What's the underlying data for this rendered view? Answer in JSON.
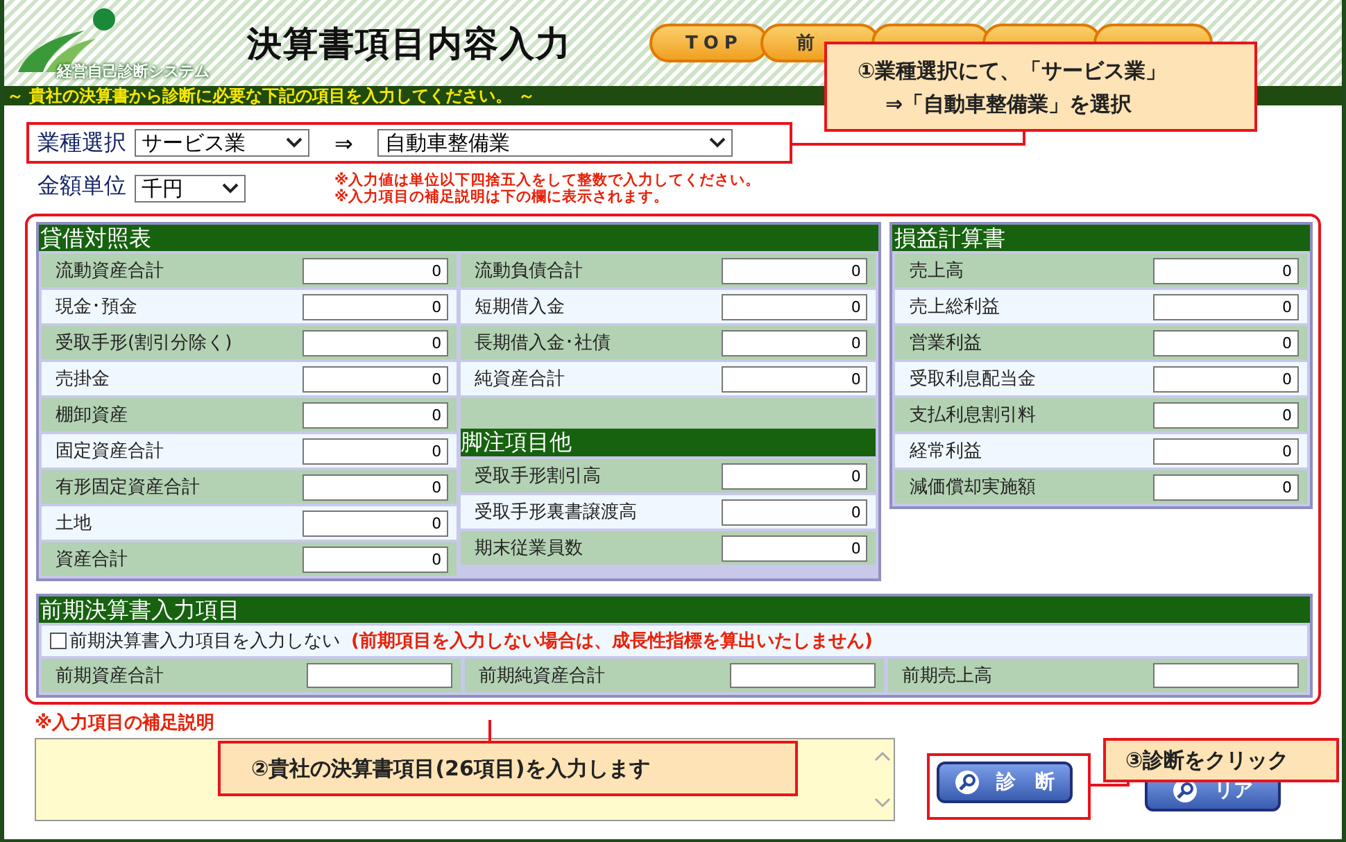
{
  "header": {
    "logo_text": "経営自己診断システム",
    "title": "決算書項目内容入力",
    "nav": [
      "TOP",
      "前"
    ],
    "notice": "～ 貴社の決算書から診断に必要な下記の項目を入力してください。 ～"
  },
  "selection": {
    "industry_label": "業種選択",
    "major": "サービス業",
    "arrow": "⇒",
    "minor": "自動車整備業",
    "unit_label": "金額単位",
    "unit": "千円",
    "notes": [
      "※入力値は単位以下四捨五入をして整数で入力してください。",
      "※入力項目の補足説明は下の欄に表示されます。"
    ]
  },
  "balance_sheet": {
    "title": "貸借対照表",
    "left_items": [
      {
        "label": "流動資産合計",
        "value": "0"
      },
      {
        "label": "現金･預金",
        "value": "0"
      },
      {
        "label": "受取手形(割引分除く)",
        "value": "0"
      },
      {
        "label": "売掛金",
        "value": "0"
      },
      {
        "label": "棚卸資産",
        "value": "0"
      },
      {
        "label": "固定資産合計",
        "value": "0"
      },
      {
        "label": "有形固定資産合計",
        "value": "0"
      },
      {
        "label": "土地",
        "value": "0"
      },
      {
        "label": "資産合計",
        "value": "0"
      }
    ],
    "right_items": [
      {
        "label": "流動負債合計",
        "value": "0"
      },
      {
        "label": "短期借入金",
        "value": "0"
      },
      {
        "label": "長期借入金･社債",
        "value": "0"
      },
      {
        "label": "純資産合計",
        "value": "0"
      }
    ],
    "footnote": {
      "title": "脚注項目他",
      "items": [
        {
          "label": "受取手形割引高",
          "value": "0"
        },
        {
          "label": "受取手形裏書譲渡高",
          "value": "0"
        },
        {
          "label": "期末従業員数",
          "value": "0"
        }
      ]
    }
  },
  "income_statement": {
    "title": "損益計算書",
    "items": [
      {
        "label": "売上高",
        "value": "0"
      },
      {
        "label": "売上総利益",
        "value": "0"
      },
      {
        "label": "営業利益",
        "value": "0"
      },
      {
        "label": "受取利息配当金",
        "value": "0"
      },
      {
        "label": "支払利息割引料",
        "value": "0"
      },
      {
        "label": "経常利益",
        "value": "0"
      },
      {
        "label": "減価償却実施額",
        "value": "0"
      }
    ]
  },
  "previous": {
    "title": "前期決算書入力項目",
    "checkbox": {
      "label": "前期決算書入力項目を入力しない",
      "checked": false
    },
    "warning": "(前期項目を入力しない場合は、成長性指標を算出いたしません)",
    "fields": [
      {
        "label": "前期資産合計"
      },
      {
        "label": "前期純資産合計"
      },
      {
        "label": "前期売上高"
      }
    ]
  },
  "supplement": {
    "label": "※入力項目の補足説明"
  },
  "buttons": [
    {
      "kind": "diagnose",
      "label": "診　断"
    },
    {
      "kind": "clear",
      "label": "リア"
    }
  ],
  "callouts": [
    {
      "lines": [
        "①業種選択にて、「サービス業」",
        "⇒「自動車整備業」を選択"
      ]
    },
    {
      "lines": [
        "②貴社の決算書項目(26項目)を入力します"
      ]
    },
    {
      "lines": [
        "③診断をクリック"
      ]
    }
  ]
}
